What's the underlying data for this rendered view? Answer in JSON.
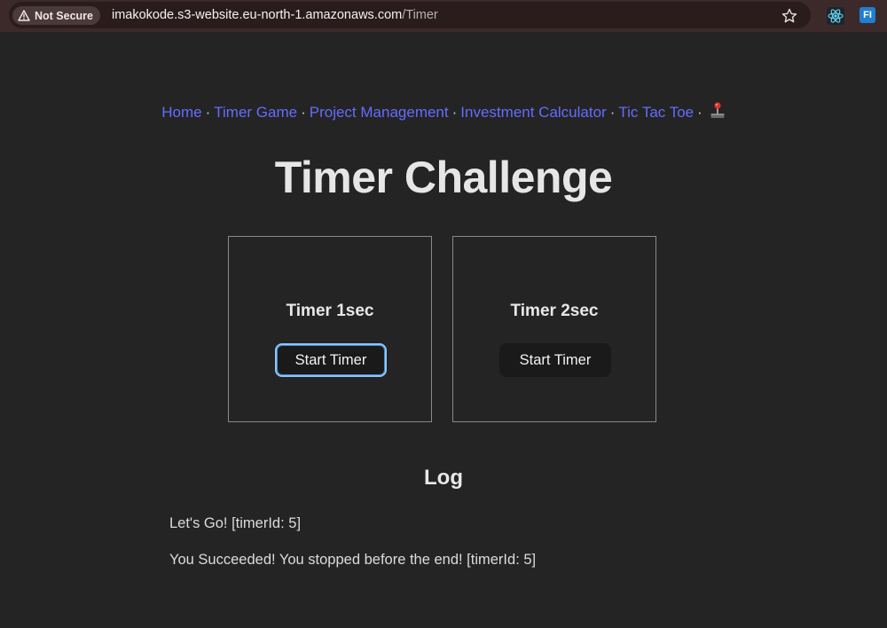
{
  "browser": {
    "security_label": "Not Secure",
    "url_host": "imakokode.s3-website.eu-north-1.amazonaws.com",
    "url_path": "/Timer",
    "icons": [
      "warning-icon",
      "star-icon",
      "react-devtools-icon",
      "fi-extension-icon"
    ],
    "fi_label": "FI"
  },
  "nav": {
    "items": [
      {
        "label": "Home"
      },
      {
        "label": "Timer Game"
      },
      {
        "label": "Project Management"
      },
      {
        "label": "Investment Calculator"
      },
      {
        "label": "Tic Tac Toe"
      }
    ],
    "separator": "·",
    "trailing_icon": "joystick-icon"
  },
  "page": {
    "title": "Timer Challenge"
  },
  "challenges": [
    {
      "title": "Timer 1sec",
      "button_label": "Start Timer",
      "focused": true
    },
    {
      "title": "Timer 2sec",
      "button_label": "Start Timer",
      "focused": false
    }
  ],
  "log": {
    "title": "Log",
    "entries": [
      "Let's Go! [timerId: 5]",
      "You Succeeded! You stopped before the end! [timerId: 5]"
    ]
  },
  "colors": {
    "background": "#242424",
    "link": "#646cff",
    "focus_ring": "#8ec5ff",
    "button_bg": "#1a1a1a"
  }
}
